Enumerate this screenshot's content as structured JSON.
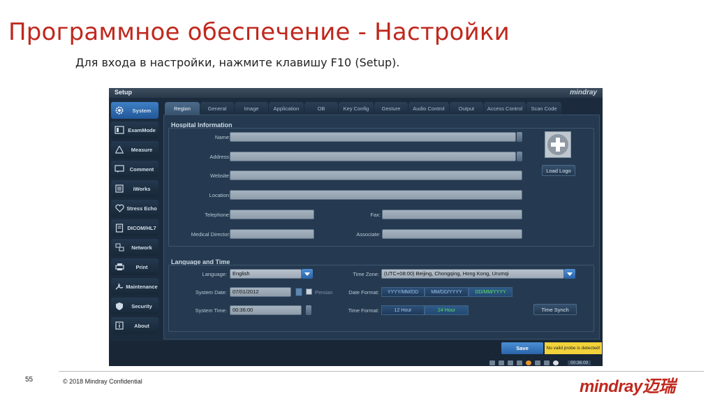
{
  "slide": {
    "title": "Программное обеспечение - Настройки",
    "subtitle": "Для входа в настройки, нажмите клавишу F10 (Setup).",
    "page_number": "55",
    "copyright": "© 2018  Mindray Confidential",
    "brand": "mindray迈瑞"
  },
  "screen": {
    "title": "Setup",
    "logo": "mindray",
    "sidebar": [
      {
        "label": "System",
        "icon": "gear-icon",
        "active": true
      },
      {
        "label": "ExamMode",
        "icon": "exam-mode-icon"
      },
      {
        "label": "Measure",
        "icon": "measure-icon"
      },
      {
        "label": "Comment",
        "icon": "comment-icon"
      },
      {
        "label": "iWorks",
        "icon": "iworks-icon"
      },
      {
        "label": "Stress Echo",
        "icon": "heart-icon"
      },
      {
        "label": "DICOM/HL7",
        "icon": "dicom-icon"
      },
      {
        "label": "Network",
        "icon": "network-icon"
      },
      {
        "label": "Print",
        "icon": "printer-icon"
      },
      {
        "label": "Maintenance",
        "icon": "maintenance-icon"
      },
      {
        "label": "Security",
        "icon": "shield-icon"
      },
      {
        "label": "About",
        "icon": "info-icon"
      }
    ],
    "tabs": [
      "Region",
      "General",
      "Image",
      "Application",
      "OB",
      "Key Config",
      "Gesture",
      "Audio Control",
      "Output",
      "Access Control",
      "Scan Code"
    ],
    "active_tab": "Region",
    "hospital": {
      "title": "Hospital Information",
      "name_label": "Name:",
      "name_value": "",
      "address_label": "Address:",
      "address_value": "",
      "website_label": "Website:",
      "website_value": "",
      "location_label": "Location:",
      "location_value": "",
      "telephone_label": "Telephone:",
      "telephone_value": "",
      "fax_label": "Fax:",
      "fax_value": "",
      "director_label": "Medical Director:",
      "director_value": "",
      "associate_label": "Associate:",
      "associate_value": "",
      "load_logo": "Load Logo"
    },
    "language_time": {
      "title": "Language and Time",
      "language_label": "Language:",
      "language_value": "English",
      "timezone_label": "Time Zone:",
      "timezone_value": "(UTC+08:00) Beijing, Chongqing, Hong Kong, Urumqi",
      "date_label": "System Date:",
      "date_value": "07/01/2012",
      "persian_label": "Persian",
      "date_format_label": "Date Format:",
      "date_formats": [
        "YYYY/MM/DD",
        "MM/DD/YYYY",
        "DD/MM/YYYY"
      ],
      "time_label": "System Time:",
      "time_value": "00:36:00",
      "time_format_label": "Time Format:",
      "time_formats": [
        "12 Hour",
        "24 Hour"
      ],
      "time_synch": "Time Synch"
    },
    "bottom": {
      "save": "Save",
      "warning": "No valid probe is detected!",
      "clock": "00:36:00"
    },
    "colors": {
      "accent": "#2a63a8",
      "active_option": "#5fe06a",
      "warning": "#f2d23a"
    }
  }
}
